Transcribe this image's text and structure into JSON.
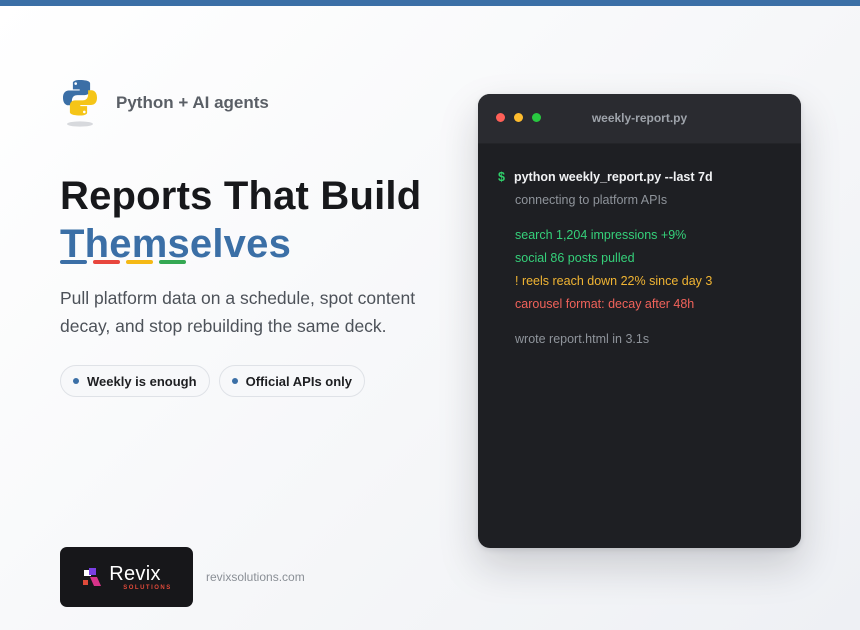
{
  "brand": {
    "tagline": "Python + AI agents",
    "logo_icon": "python-logo-icon"
  },
  "headline": {
    "line1": "Reports That Build",
    "line2": "Themselves"
  },
  "accent_dash_colors": [
    "#3b6fa6",
    "#e8463d",
    "#f5b915",
    "#34a853"
  ],
  "subtext": "Pull platform data on a schedule, spot content decay, and stop rebuilding the same deck.",
  "pills": [
    {
      "label": "Weekly is enough"
    },
    {
      "label": "Official APIs only"
    }
  ],
  "footer": {
    "company_logo_name": "Revix",
    "company_logo_sub": "SOLUTIONS",
    "url": "revixsolutions.com"
  },
  "terminal": {
    "title": "weekly-report.py",
    "prompt": "$",
    "command": "python weekly_report.py --last 7d",
    "lines": [
      {
        "text": "connecting to platform APIs",
        "tone": "gray"
      },
      {
        "text": "search 1,204 impressions +9%",
        "tone": "green"
      },
      {
        "text": "social 86 posts pulled",
        "tone": "green"
      },
      {
        "text": "! reels reach down 22% since day 3",
        "tone": "yellow"
      },
      {
        "text": "carousel format: decay after 48h",
        "tone": "red"
      },
      {
        "text": "wrote report.html in 3.1s",
        "tone": "gray"
      }
    ]
  },
  "colors": {
    "accent": "#3b6fa6",
    "terminal_bg": "#1e1f23",
    "success": "#35d07a",
    "warning": "#f0b433",
    "error": "#f0625a"
  }
}
